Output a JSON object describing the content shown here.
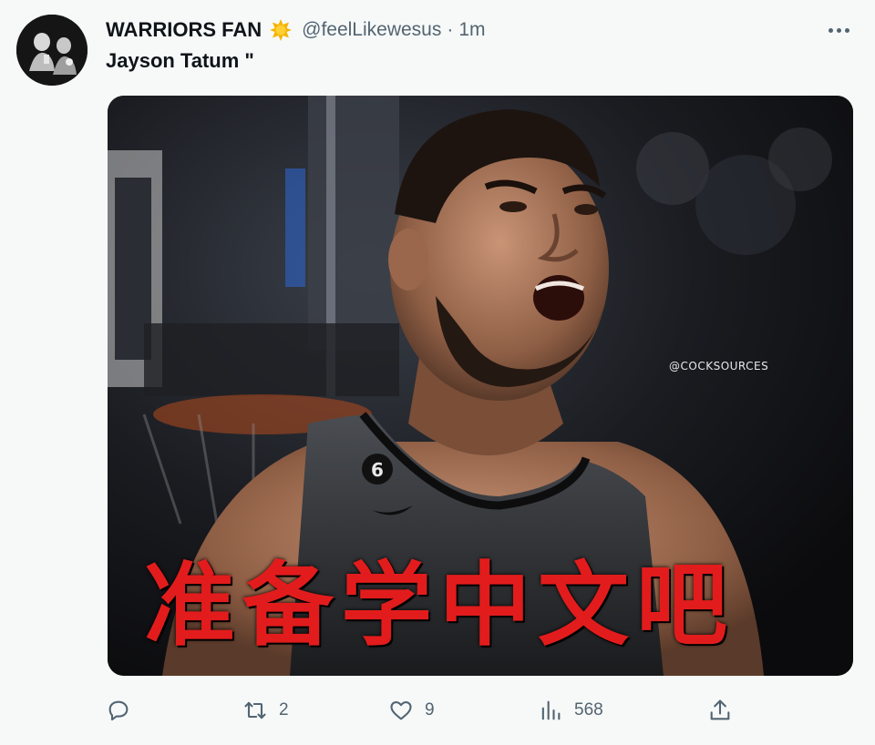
{
  "tweet": {
    "display_name": "WARRIORS FAN",
    "badge_icon": "sun-badge-icon",
    "handle": "@feelLikewesus",
    "separator": "·",
    "time": "1m",
    "text": "Jayson Tatum \""
  },
  "media": {
    "watermark": "@COCKSOURCES",
    "caption": "准备学中文吧",
    "caption_color": "#e21c1c"
  },
  "actions": {
    "reply": {
      "icon": "reply-icon",
      "count": ""
    },
    "retweet": {
      "icon": "retweet-icon",
      "count": "2"
    },
    "like": {
      "icon": "heart-icon",
      "count": "9"
    },
    "views": {
      "icon": "views-chart-icon",
      "count": "568"
    },
    "share": {
      "icon": "share-icon",
      "count": ""
    }
  },
  "colors": {
    "secondary_text": "#536471",
    "primary_text": "#0f1419",
    "background": "#f7f9f9"
  }
}
